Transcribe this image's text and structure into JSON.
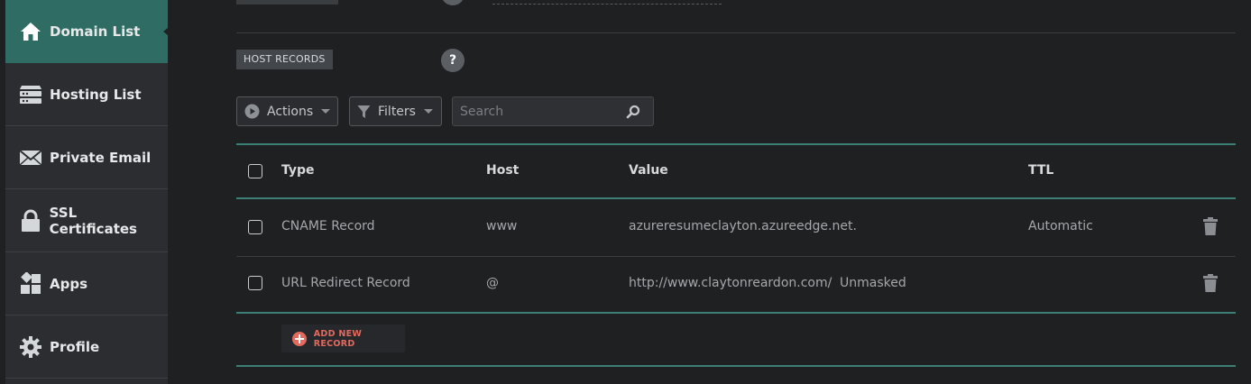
{
  "sidebar": {
    "items": [
      {
        "label": "Domain List",
        "icon": "home-icon"
      },
      {
        "label": "Hosting List",
        "icon": "server-icon"
      },
      {
        "label": "Private Email",
        "icon": "envelope-icon"
      },
      {
        "label": "SSL Certificates",
        "icon": "lock-icon"
      },
      {
        "label": "Apps",
        "icon": "apps-icon"
      },
      {
        "label": "Profile",
        "icon": "gear-icon"
      }
    ],
    "active_index": 0
  },
  "section": {
    "label": "HOST RECORDS",
    "help_glyph": "?"
  },
  "toolbar": {
    "actions_label": "Actions",
    "filters_label": "Filters",
    "search_placeholder": "Search"
  },
  "table": {
    "headers": [
      "Type",
      "Host",
      "Value",
      "TTL"
    ],
    "rows": [
      {
        "type": "CNAME Record",
        "host": "www",
        "value": "azureresumeclayton.azureedge.net.",
        "extra": "",
        "ttl": "Automatic"
      },
      {
        "type": "URL Redirect Record",
        "host": "@",
        "value": "http://www.claytonreardon.com/",
        "extra": "Unmasked",
        "ttl": ""
      }
    ]
  },
  "add_record": {
    "label": "ADD NEW RECORD"
  },
  "colors": {
    "background": "#1f2022",
    "sidebar": "#2b2d30",
    "active_nav": "#2f6d64",
    "accent_line": "#3c7f77",
    "add_record": "#e36a5e"
  }
}
